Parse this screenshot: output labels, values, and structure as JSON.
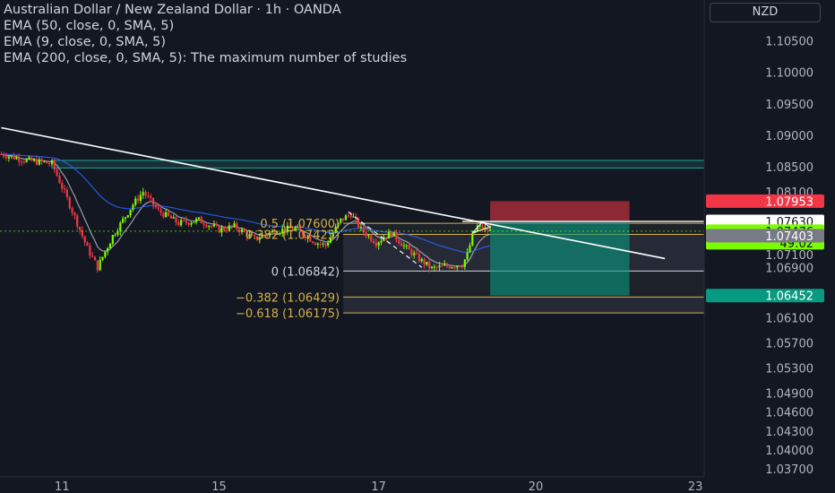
{
  "legend": {
    "title": "Australian Dollar / New Zealand Dollar · 1h · OANDA",
    "ema50": "EMA (50, close, 0, SMA, 5)",
    "ema9": "EMA (9, close, 0, SMA, 5)",
    "ema200": "EMA (200, close, 0, SMA, 5): The maximum number of studies"
  },
  "currency_button": "NZD",
  "colors": {
    "background": "#131722",
    "up": "#7cfc00",
    "down": "#f23645",
    "zone": "#26a69a",
    "fib": "#d4b04a",
    "stop": "#f23645",
    "target": "#089981",
    "trend": "#ffffff",
    "ema_fast": "#b2b5be",
    "ema_slow": "#2962ff"
  },
  "chart_data": {
    "type": "candlestick",
    "y_axis": {
      "range": [
        1.0357,
        1.1115
      ],
      "ticks": [
        "1.11000",
        "1.10500",
        "1.10000",
        "1.09500",
        "1.09000",
        "1.08500",
        "1.08100",
        "1.07600",
        "1.07100",
        "1.06900",
        "1.06100",
        "1.05700",
        "1.05300",
        "1.04900",
        "1.04600",
        "1.04300",
        "1.04000",
        "1.03700"
      ],
      "tick_values": [
        1.11,
        1.105,
        1.1,
        1.095,
        1.09,
        1.085,
        1.081,
        1.076,
        1.071,
        1.069,
        1.061,
        1.057,
        1.053,
        1.049,
        1.046,
        1.043,
        1.04,
        1.037
      ]
    },
    "x_axis": {
      "labels": [
        "11",
        "15",
        "17",
        "20",
        "23"
      ],
      "label_bars": [
        24,
        86,
        149,
        211,
        274
      ],
      "total_bars": 278
    },
    "price_labels": [
      {
        "text": "1.07953",
        "value": 1.07953,
        "color": "#f23645"
      },
      {
        "text": "1.07630",
        "value": 1.0763,
        "color": "#ffffff"
      },
      {
        "text": "1.07476",
        "value": 1.07476,
        "color": "#7cfc00",
        "sub": "49:02"
      },
      {
        "text": "1.07403",
        "value": 1.07403,
        "color": "#787b86"
      },
      {
        "text": "1.06452",
        "value": 1.06452,
        "color": "#089981"
      }
    ],
    "fib_levels": [
      {
        "label": "0.5 (1.07600)",
        "value": 1.076
      },
      {
        "label": "0.382 (1.07425)",
        "value": 1.07425
      },
      {
        "label": "0 (1.06842)",
        "value": 1.06842
      },
      {
        "label": "−0.382 (1.06429)",
        "value": 1.06429
      },
      {
        "label": "−0.618 (1.06175)",
        "value": 1.06175
      }
    ],
    "zone": {
      "top": 1.086,
      "bottom": 1.0848,
      "from_bar": 20
    },
    "position": {
      "entry": 1.0762,
      "stop": 1.07953,
      "target": 1.06452,
      "from_bar": 193,
      "to_bar": 248
    },
    "trendline": [
      {
        "bar": 0,
        "price": 1.0912
      },
      {
        "bar": 262,
        "price": 1.0704
      }
    ],
    "close_marks": [
      {
        "bar": 0,
        "c": 1.087
      },
      {
        "bar": 10,
        "c": 1.086
      },
      {
        "bar": 20,
        "c": 1.0855
      },
      {
        "bar": 28,
        "c": 1.078
      },
      {
        "bar": 34,
        "c": 1.072
      },
      {
        "bar": 38,
        "c": 1.069
      },
      {
        "bar": 44,
        "c": 1.074
      },
      {
        "bar": 52,
        "c": 1.079
      },
      {
        "bar": 56,
        "c": 1.081
      },
      {
        "bar": 62,
        "c": 1.078
      },
      {
        "bar": 70,
        "c": 1.076
      },
      {
        "bar": 78,
        "c": 1.0765
      },
      {
        "bar": 86,
        "c": 1.075
      },
      {
        "bar": 92,
        "c": 1.0755
      },
      {
        "bar": 100,
        "c": 1.0735
      },
      {
        "bar": 108,
        "c": 1.0748
      },
      {
        "bar": 116,
        "c": 1.0752
      },
      {
        "bar": 124,
        "c": 1.073
      },
      {
        "bar": 128,
        "c": 1.0725
      },
      {
        "bar": 134,
        "c": 1.0765
      },
      {
        "bar": 138,
        "c": 1.0775
      },
      {
        "bar": 142,
        "c": 1.075
      },
      {
        "bar": 148,
        "c": 1.073
      },
      {
        "bar": 154,
        "c": 1.0745
      },
      {
        "bar": 160,
        "c": 1.072
      },
      {
        "bar": 166,
        "c": 1.07
      },
      {
        "bar": 170,
        "c": 1.0688
      },
      {
        "bar": 176,
        "c": 1.0692
      },
      {
        "bar": 182,
        "c": 1.0695
      },
      {
        "bar": 184,
        "c": 1.071
      },
      {
        "bar": 186,
        "c": 1.074
      },
      {
        "bar": 188,
        "c": 1.0755
      },
      {
        "bar": 193,
        "c": 1.0748
      }
    ]
  }
}
